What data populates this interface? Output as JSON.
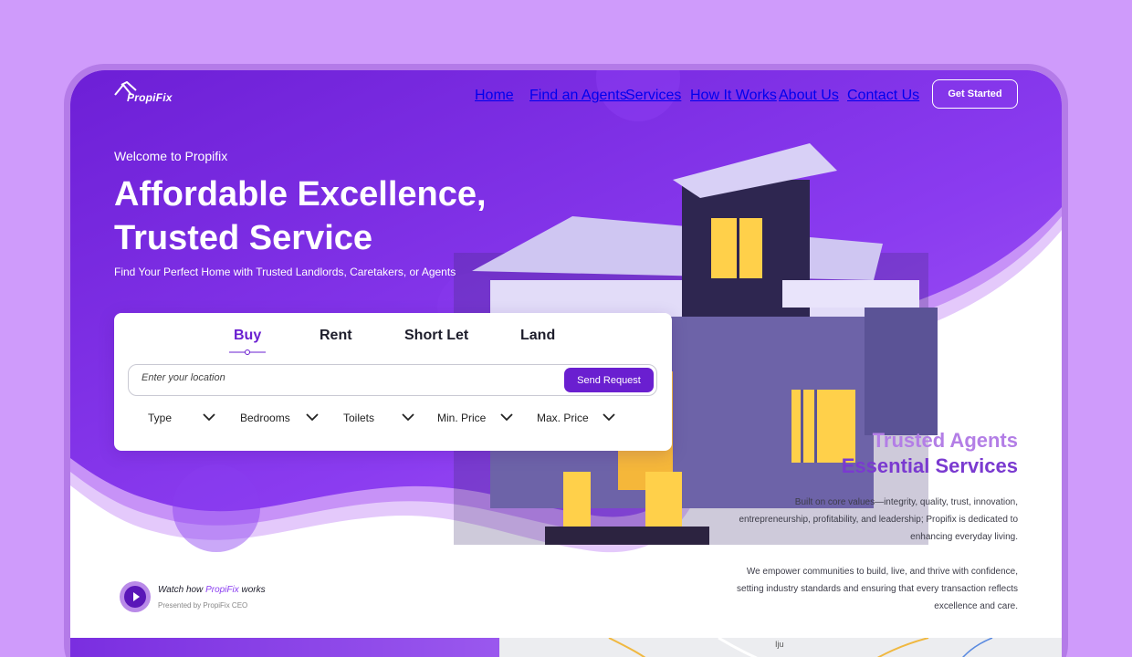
{
  "brand": {
    "name_main": "Propi",
    "name_accent": "Fix"
  },
  "nav": {
    "items": [
      {
        "label": "Home",
        "id": "home"
      },
      {
        "label": "Find an Agents",
        "id": "find-agents"
      },
      {
        "label": "Services",
        "id": "services"
      },
      {
        "label": "How It Works",
        "id": "how-it-works"
      },
      {
        "label": "About Us",
        "id": "about-us"
      },
      {
        "label": "Contact Us",
        "id": "contact-us"
      }
    ],
    "cta": "Get Started"
  },
  "hero": {
    "welcome": "Welcome to Propifix",
    "title_line1": "Affordable Excellence,",
    "title_line2": "Trusted Service",
    "subtitle": "Find Your Perfect Home with Trusted Landlords, Caretakers, or Agents"
  },
  "search": {
    "tabs": [
      "Buy",
      "Rent",
      "Short Let",
      "Land"
    ],
    "active_tab": "Buy",
    "location_placeholder": "Enter your location",
    "location_value": "",
    "send_label": "Send Request",
    "filters": [
      "Type",
      "Bedrooms",
      "Toilets",
      "Min. Price",
      "Max. Price"
    ]
  },
  "tagline": {
    "line1": "Trusted Agents",
    "line2": "Essential Services"
  },
  "about": {
    "para1": "Built on core values—integrity, quality, trust, innovation, entrepreneurship, profitability, and  leadership; Propifix is dedicated to enhancing everyday living.",
    "para2": "We empower communities to  build, live, and thrive with confidence, setting industry standards and ensuring that every transaction reflects excellence and care."
  },
  "video": {
    "watch_prefix": "Watch how ",
    "watch_brand": "PropiFix",
    "watch_suffix": " works",
    "presented_by": "Presented by PropiFix CEO"
  },
  "map": {
    "label": "Iju"
  },
  "colors": {
    "page_bg": "#cf9bfb",
    "primary": "#6a1fd0",
    "hero_purple": "#7b2ee4",
    "accent_light": "#b37ee6",
    "accent_dark": "#7a3ad0"
  }
}
